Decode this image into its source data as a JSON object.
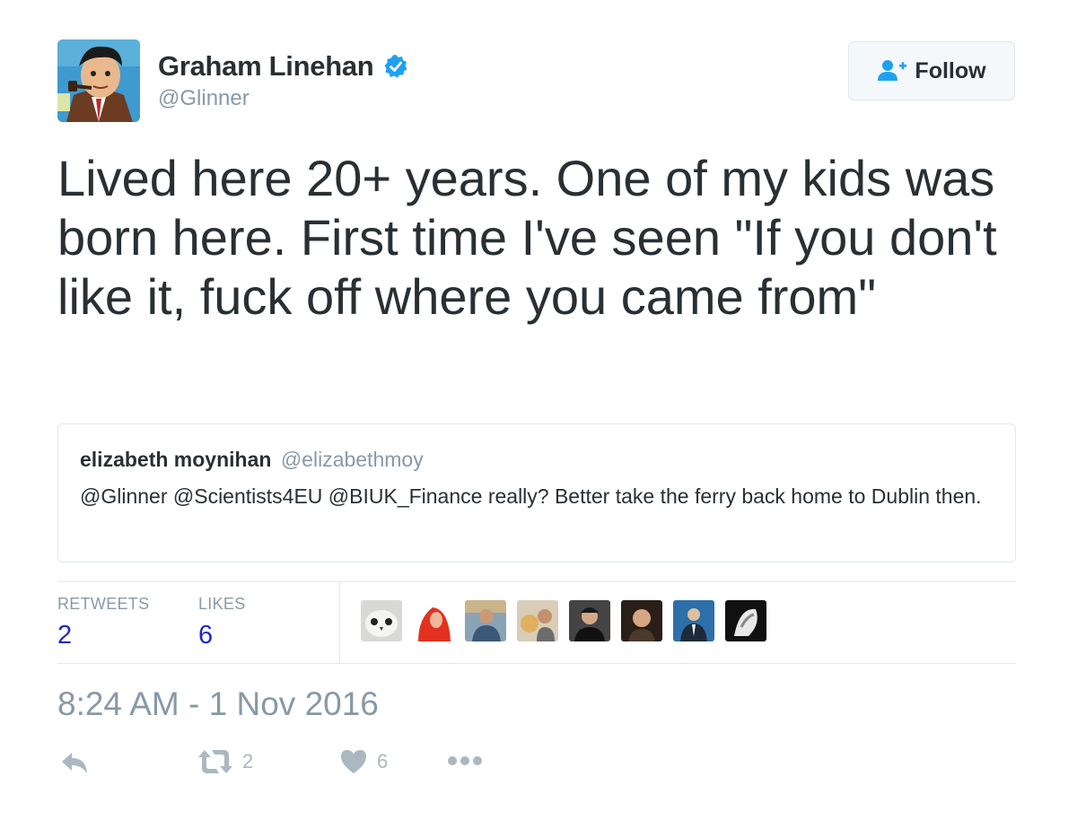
{
  "user": {
    "display_name": "Graham Linehan",
    "handle": "@Glinner",
    "verified": true,
    "avatar_icon": "avatar-illustration"
  },
  "follow_button": {
    "label": "Follow",
    "icon": "add-user-icon"
  },
  "tweet": {
    "text": "Lived here 20+ years. One of my kids was born here. First time I've seen \"If you don't like it, fuck off where you came from\""
  },
  "quoted_tweet": {
    "name": "elizabeth moynihan",
    "handle": "@elizabethmoy",
    "text": "@Glinner @Scientists4EU @BIUK_Finance really? Better take the ferry back home to Dublin then."
  },
  "stats": {
    "retweets_label": "RETWEETS",
    "retweets_value": "2",
    "likes_label": "LIKES",
    "likes_value": "6",
    "likers_count": 8
  },
  "timestamp": "8:24 AM - 1 Nov 2016",
  "actions": {
    "reply_icon": "reply-icon",
    "retweet_icon": "retweet-icon",
    "retweet_count": "2",
    "like_icon": "heart-icon",
    "like_count": "6",
    "more_icon": "more-dots-icon"
  },
  "colors": {
    "accent_blue": "#1da1f2",
    "stat_value": "#1b2bc0",
    "secondary_text": "#8899a6",
    "action_gray": "#aab8c2"
  }
}
